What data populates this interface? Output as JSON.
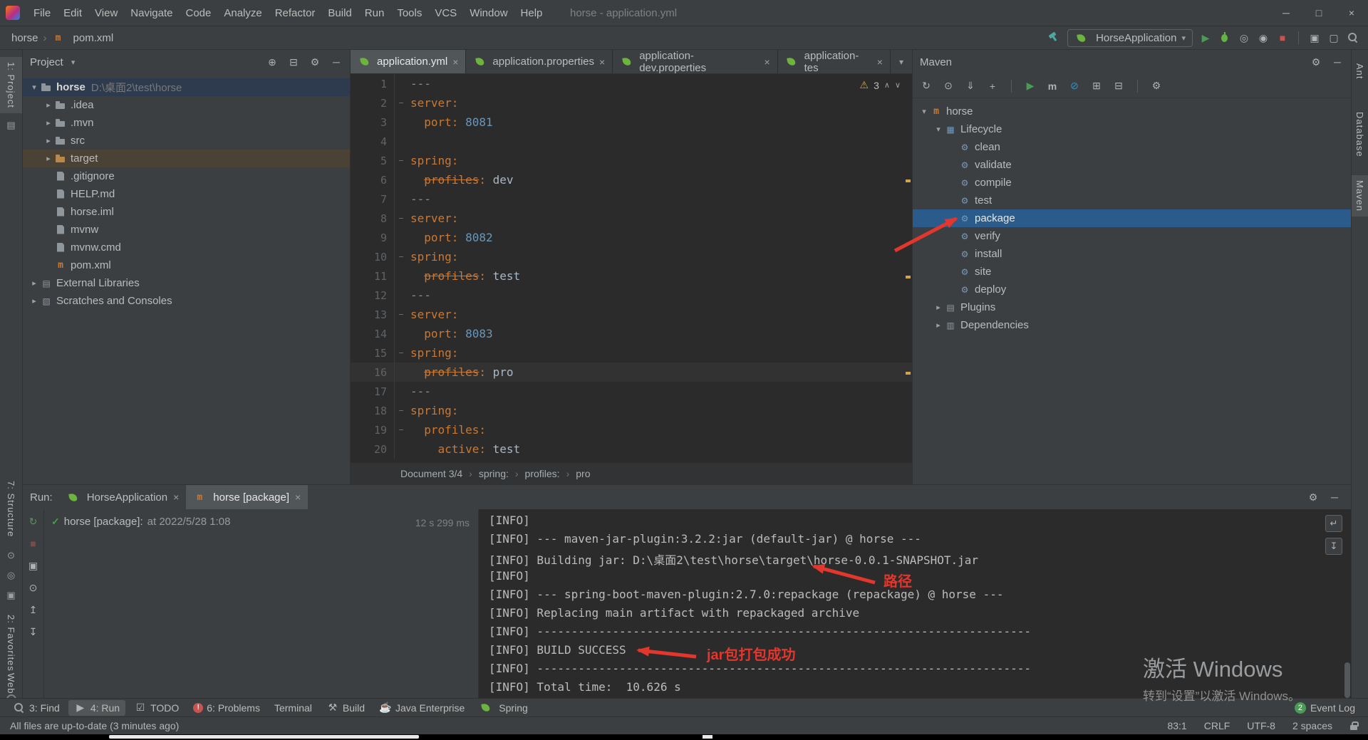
{
  "colors": {
    "panel": "#3c3f41",
    "editor": "#2b2b2b",
    "border": "#323232",
    "selection_blue": "#2b5b8a",
    "root_selection": "#2e3b4e",
    "target_highlight": "#4a4234",
    "key_orange": "#cb7832",
    "number_blue": "#6897bb",
    "value_gray": "#a9b7c6",
    "annotation_red": "#e3362c",
    "green": "#499c54",
    "warning_orange": "#d9a343"
  },
  "window": {
    "title": "horse - application.yml",
    "menus": [
      "File",
      "Edit",
      "View",
      "Navigate",
      "Code",
      "Analyze",
      "Refactor",
      "Build",
      "Run",
      "Tools",
      "VCS",
      "Window",
      "Help"
    ],
    "controls": {
      "minimize": "─",
      "maximize": "□",
      "close": "×"
    }
  },
  "toolbar": {
    "breadcrumb": {
      "project": "horse",
      "separator": "›",
      "file": "pom.xml"
    },
    "run_config": "HorseApplication",
    "actions": [
      {
        "name": "run-icon",
        "glyph": "▶",
        "color": "#499c54"
      },
      {
        "name": "debug-icon",
        "css": "bug"
      },
      {
        "name": "coverage-icon",
        "glyph": "◎"
      },
      {
        "name": "profiler-icon",
        "glyph": "◉"
      },
      {
        "name": "stop-icon",
        "glyph": "■",
        "color": "#c75450"
      },
      {
        "name": "divider"
      },
      {
        "name": "toolbox-icon",
        "glyph": "▣"
      },
      {
        "name": "layout-icon",
        "glyph": "▢"
      },
      {
        "name": "search-everywhere-icon",
        "css": "search"
      }
    ]
  },
  "left_stripe": {
    "project": "1: Project",
    "structure": "7: Structure",
    "favorites": "2: Favorites",
    "web": "Web",
    "more": "»"
  },
  "right_stripe": {
    "ant": "Ant",
    "database": "Database",
    "maven": "Maven"
  },
  "project_panel": {
    "title": "Project",
    "header_icons": [
      {
        "name": "select-opened-file-icon",
        "glyph": "⊕"
      },
      {
        "name": "collapse-all-icon",
        "glyph": "⊟"
      },
      {
        "name": "settings-icon",
        "glyph": "⚙"
      },
      {
        "name": "hide-panel-icon",
        "glyph": "─"
      }
    ],
    "tree": [
      {
        "label": "horse",
        "path": "D:\\桌面2\\test\\horse",
        "icon": "project",
        "chev": "v",
        "indent": 0,
        "sel": "sel-root",
        "bold": true
      },
      {
        "label": ".idea",
        "icon": "folder",
        "chev": ">",
        "indent": 1
      },
      {
        "label": ".mvn",
        "icon": "folder",
        "chev": ">",
        "indent": 1
      },
      {
        "label": "src",
        "icon": "folder",
        "chev": ">",
        "indent": 1
      },
      {
        "label": "target",
        "icon": "folder-ex",
        "chev": ">",
        "indent": 1,
        "sel": "sel-target"
      },
      {
        "label": ".gitignore",
        "icon": "file-git",
        "indent": 1
      },
      {
        "label": "HELP.md",
        "icon": "file-md",
        "indent": 1
      },
      {
        "label": "horse.iml",
        "icon": "file-iml",
        "indent": 1
      },
      {
        "label": "mvnw",
        "icon": "file-sh",
        "indent": 1
      },
      {
        "label": "mvnw.cmd",
        "icon": "file-cmd",
        "indent": 1
      },
      {
        "label": "pom.xml",
        "icon": "file-mvn",
        "indent": 1
      },
      {
        "label": "External Libraries",
        "icon": "libs",
        "chev": ">",
        "indent": 0
      },
      {
        "label": "Scratches and Consoles",
        "icon": "scratch",
        "chev": ">",
        "indent": 0
      }
    ]
  },
  "editor": {
    "tabs": [
      {
        "label": "application.yml",
        "active": true
      },
      {
        "label": "application.properties",
        "active": false
      },
      {
        "label": "application-dev.properties",
        "active": false
      },
      {
        "label": "application-tes",
        "active": false
      }
    ],
    "inspections": {
      "warnings": "3"
    },
    "lines": [
      {
        "n": "1",
        "t": [
          [
            "---",
            "sep"
          ]
        ]
      },
      {
        "n": "2",
        "t": [
          [
            "server:",
            "key"
          ]
        ],
        "fold": true
      },
      {
        "n": "3",
        "t": [
          [
            "  ",
            ""
          ],
          [
            "port:",
            "key"
          ],
          [
            " ",
            ""
          ],
          [
            "8081",
            "num"
          ]
        ]
      },
      {
        "n": "4",
        "t": []
      },
      {
        "n": "5",
        "t": [
          [
            "spring:",
            "key"
          ]
        ],
        "fold": true
      },
      {
        "n": "6",
        "t": [
          [
            "  ",
            ""
          ],
          [
            "profiles",
            "key strike"
          ],
          [
            ":",
            "key"
          ],
          [
            " ",
            ""
          ],
          [
            "dev",
            "val"
          ]
        ]
      },
      {
        "n": "7",
        "t": [
          [
            "---",
            "sep"
          ]
        ]
      },
      {
        "n": "8",
        "t": [
          [
            "server:",
            "key"
          ]
        ],
        "fold": true
      },
      {
        "n": "9",
        "t": [
          [
            "  ",
            ""
          ],
          [
            "port:",
            "key"
          ],
          [
            " ",
            ""
          ],
          [
            "8082",
            "num"
          ]
        ]
      },
      {
        "n": "10",
        "t": [
          [
            "spring:",
            "key"
          ]
        ],
        "fold": true
      },
      {
        "n": "11",
        "t": [
          [
            "  ",
            ""
          ],
          [
            "profiles",
            "key strike"
          ],
          [
            ":",
            "key"
          ],
          [
            " ",
            ""
          ],
          [
            "test",
            "val"
          ]
        ]
      },
      {
        "n": "12",
        "t": [
          [
            "---",
            "sep"
          ]
        ]
      },
      {
        "n": "13",
        "t": [
          [
            "server:",
            "key"
          ]
        ],
        "fold": true
      },
      {
        "n": "14",
        "t": [
          [
            "  ",
            ""
          ],
          [
            "port:",
            "key"
          ],
          [
            " ",
            ""
          ],
          [
            "8083",
            "num"
          ]
        ]
      },
      {
        "n": "15",
        "t": [
          [
            "spring:",
            "key"
          ]
        ],
        "fold": true
      },
      {
        "n": "16",
        "t": [
          [
            "  ",
            ""
          ],
          [
            "profiles",
            "key strike"
          ],
          [
            ":",
            "key"
          ],
          [
            " ",
            ""
          ],
          [
            "pro",
            "val"
          ]
        ],
        "cur": true
      },
      {
        "n": "17",
        "t": [
          [
            "---",
            "sep"
          ]
        ]
      },
      {
        "n": "18",
        "t": [
          [
            "spring:",
            "key"
          ]
        ],
        "fold": true
      },
      {
        "n": "19",
        "t": [
          [
            "  ",
            ""
          ],
          [
            "profiles:",
            "key"
          ]
        ],
        "fold": true
      },
      {
        "n": "20",
        "t": [
          [
            "    ",
            ""
          ],
          [
            "active:",
            "key"
          ],
          [
            " ",
            ""
          ],
          [
            "test",
            "val"
          ]
        ]
      }
    ],
    "breadcrumbs": [
      "Document 3/4",
      "spring:",
      "profiles:",
      "pro"
    ]
  },
  "maven_panel": {
    "title": "Maven",
    "header_icons": [
      {
        "name": "settings-icon",
        "glyph": "⚙"
      },
      {
        "name": "hide-panel-icon",
        "glyph": "─"
      }
    ],
    "toolbar": [
      {
        "name": "refresh-icon",
        "glyph": "↻"
      },
      {
        "name": "generate-sources-icon",
        "glyph": "⊙"
      },
      {
        "name": "download-sources-icon",
        "glyph": "⇓"
      },
      {
        "name": "add-maven-project-icon",
        "glyph": "+"
      },
      {
        "name": "divider"
      },
      {
        "name": "run-build-icon",
        "glyph": "▶",
        "color": "#499c54"
      },
      {
        "name": "execute-goal-icon",
        "glyph": "m",
        "bold": true
      },
      {
        "name": "skip-tests-icon",
        "glyph": "⊘",
        "color": "#3592c4"
      },
      {
        "name": "expand-all-icon",
        "glyph": "⊞"
      },
      {
        "name": "collapse-all-icon",
        "glyph": "⊟"
      },
      {
        "name": "divider"
      },
      {
        "name": "maven-settings-icon",
        "glyph": "⚙"
      }
    ],
    "tree": [
      {
        "label": "horse",
        "icon": "mvn-project",
        "chev": "v",
        "indent": 0
      },
      {
        "label": "Lifecycle",
        "icon": "lifecycle",
        "chev": "v",
        "indent": 1
      },
      {
        "label": "clean",
        "icon": "goal",
        "indent": 2
      },
      {
        "label": "validate",
        "icon": "goal",
        "indent": 2
      },
      {
        "label": "compile",
        "icon": "goal",
        "indent": 2
      },
      {
        "label": "test",
        "icon": "goal",
        "indent": 2
      },
      {
        "label": "package",
        "icon": "goal",
        "indent": 2,
        "sel": "sel-blue"
      },
      {
        "label": "verify",
        "icon": "goal",
        "indent": 2
      },
      {
        "label": "install",
        "icon": "goal",
        "indent": 2
      },
      {
        "label": "site",
        "icon": "goal",
        "indent": 2
      },
      {
        "label": "deploy",
        "icon": "goal",
        "indent": 2
      },
      {
        "label": "Plugins",
        "icon": "plugins",
        "chev": ">",
        "indent": 1
      },
      {
        "label": "Dependencies",
        "icon": "deps",
        "chev": ">",
        "indent": 1
      }
    ]
  },
  "run_panel": {
    "label": "Run:",
    "tabs": [
      {
        "label": "HorseApplication",
        "icon": "spring",
        "active": false
      },
      {
        "label": "horse [package]",
        "icon": "maven",
        "active": true
      }
    ],
    "header_icons": [
      {
        "name": "settings-icon",
        "glyph": "⚙"
      },
      {
        "name": "hide-panel-icon",
        "glyph": "─"
      }
    ],
    "left_icons": [
      {
        "name": "rerun-icon",
        "glyph": "↻",
        "color": "#499c54"
      },
      {
        "name": "stop-icon",
        "glyph": "■",
        "color": "#7c4a48"
      },
      {
        "name": "restore-layout-icon",
        "glyph": "▣"
      },
      {
        "name": "pin-tab-icon",
        "glyph": "⊙"
      },
      {
        "name": "up-icon",
        "glyph": "↥"
      },
      {
        "name": "down-icon",
        "glyph": "↧"
      }
    ],
    "console_buttons": [
      {
        "name": "soft-wrap-icon",
        "glyph": "↵"
      },
      {
        "name": "scroll-to-end-icon",
        "glyph": "↧"
      }
    ],
    "result": {
      "text": "horse [package]:",
      "suffix": " at 2022/5/28 1:08",
      "duration": "12 s 299 ms"
    },
    "console": [
      "[INFO]",
      "[INFO] --- maven-jar-plugin:3.2.2:jar (default-jar) @ horse ---",
      "[INFO] Building jar: D:\\桌面2\\test\\horse\\target\\horse-0.0.1-SNAPSHOT.jar",
      "[INFO]",
      "[INFO] --- spring-boot-maven-plugin:2.7.0:repackage (repackage) @ horse ---",
      "[INFO] Replacing main artifact with repackaged archive",
      "[INFO] ------------------------------------------------------------------------",
      "[INFO] BUILD SUCCESS",
      "[INFO] ------------------------------------------------------------------------",
      "[INFO] Total time:  10.626 s"
    ]
  },
  "bottom_bar": {
    "items": [
      {
        "label": "3: Find",
        "icon": "find"
      },
      {
        "label": "4: Run",
        "icon": "run",
        "active": true
      },
      {
        "label": "TODO",
        "icon": "todo"
      },
      {
        "label": "6: Problems",
        "icon": "problems"
      },
      {
        "label": "Terminal"
      },
      {
        "label": "Build",
        "icon": "build"
      },
      {
        "label": "Java Enterprise",
        "icon": "javaee"
      },
      {
        "label": "Spring",
        "icon": "spring"
      }
    ],
    "right": {
      "badge": "2",
      "label": "Event Log"
    }
  },
  "status_bar": {
    "message": "All files are up-to-date (3 minutes ago)",
    "caret": "83:1",
    "line_ending": "CRLF",
    "encoding": "UTF-8",
    "indent": "2 spaces"
  },
  "watermark": {
    "line1": "激活 Windows",
    "line2": "转到“设置”以激活 Windows。"
  },
  "annotations": {
    "color": "#e3362c",
    "path_label": "路径",
    "success_label": "jar包打包成功"
  }
}
